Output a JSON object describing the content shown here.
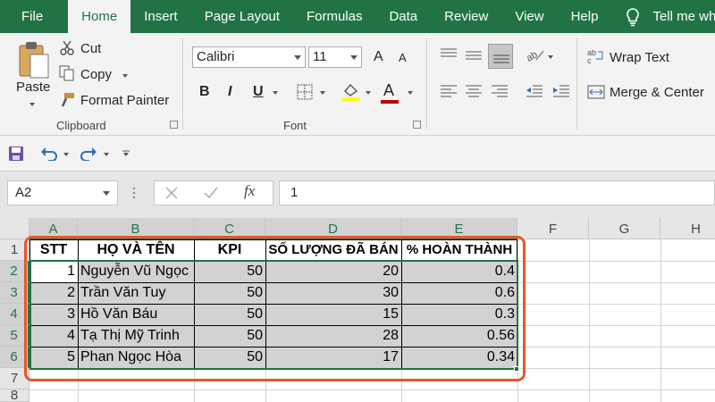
{
  "tabs": [
    "File",
    "Home",
    "Insert",
    "Page Layout",
    "Formulas",
    "Data",
    "Review",
    "View",
    "Help"
  ],
  "tell_me": "Tell me what yo",
  "clipboard": {
    "paste": "Paste",
    "cut": "Cut",
    "copy": "Copy",
    "format_painter": "Format Painter",
    "label": "Clipboard"
  },
  "font": {
    "name": "Calibri",
    "size": "11",
    "bold": "B",
    "italic": "I",
    "underline": "U",
    "label": "Font",
    "grow": "A",
    "shrink": "A",
    "color_letter": "A",
    "fill_color": "#ffff00",
    "font_color": "#c00000"
  },
  "alignment": {
    "wrap_text": "Wrap Text",
    "merge_center": "Merge & Center"
  },
  "name_box": "A2",
  "fx": "fx",
  "formula_value": "1",
  "columns": [
    "A",
    "B",
    "C",
    "D",
    "E",
    "F",
    "G",
    "H"
  ],
  "rows": [
    "1",
    "2",
    "3",
    "4",
    "5",
    "6",
    "7",
    "8"
  ],
  "table": {
    "headers": [
      "STT",
      "HỌ VÀ TÊN",
      "KPI",
      "SỐ LƯỢNG ĐÃ BÁN",
      "% HOÀN THÀNH"
    ],
    "rows": [
      [
        "1",
        "Nguyễn Vũ Ngọc",
        "50",
        "20",
        "0.4"
      ],
      [
        "2",
        "Trần Văn Tuy",
        "50",
        "30",
        "0.6"
      ],
      [
        "3",
        "Hồ Văn Báu",
        "50",
        "15",
        "0.3"
      ],
      [
        "4",
        "Tạ Thị Mỹ Trinh",
        "50",
        "28",
        "0.56"
      ],
      [
        "5",
        "Phan Ngọc Hòa",
        "50",
        "17",
        "0.34"
      ]
    ]
  },
  "colors": {
    "accent": "#217346",
    "highlight": "#e8562a"
  }
}
